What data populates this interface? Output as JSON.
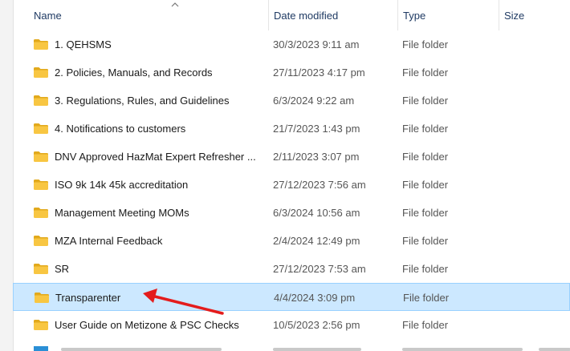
{
  "header": {
    "name": "Name",
    "date_modified": "Date modified",
    "type": "Type",
    "size": "Size"
  },
  "accent_colors": {
    "folder": "#f8c642",
    "folder_dark": "#e2a91c",
    "selection_bg": "#cce8ff",
    "selection_border": "#99d1ff",
    "annotation_arrow": "#e41c1c"
  },
  "rows": [
    {
      "name": "1. QEHSMS",
      "date": "30/3/2023 9:11 am",
      "type": "File folder",
      "icon": "folder-icon",
      "selected": false
    },
    {
      "name": "2. Policies, Manuals, and Records",
      "date": "27/11/2023 4:17 pm",
      "type": "File folder",
      "icon": "folder-icon",
      "selected": false
    },
    {
      "name": "3. Regulations, Rules, and Guidelines",
      "date": "6/3/2024 9:22 am",
      "type": "File folder",
      "icon": "folder-icon",
      "selected": false
    },
    {
      "name": "4. Notifications to customers",
      "date": "21/7/2023 1:43 pm",
      "type": "File folder",
      "icon": "folder-icon",
      "selected": false
    },
    {
      "name": "DNV Approved HazMat Expert Refresher ...",
      "date": "2/11/2023 3:07 pm",
      "type": "File folder",
      "icon": "folder-icon",
      "selected": false
    },
    {
      "name": "ISO 9k 14k 45k accreditation",
      "date": "27/12/2023 7:56 am",
      "type": "File folder",
      "icon": "folder-icon",
      "selected": false
    },
    {
      "name": "Management Meeting MOMs",
      "date": "6/3/2024 10:56 am",
      "type": "File folder",
      "icon": "folder-icon",
      "selected": false
    },
    {
      "name": "MZA Internal Feedback",
      "date": "2/4/2024 12:49 pm",
      "type": "File folder",
      "icon": "folder-icon",
      "selected": false
    },
    {
      "name": "SR",
      "date": "27/12/2023 7:53 am",
      "type": "File folder",
      "icon": "folder-icon",
      "selected": false
    },
    {
      "name": "Transparenter",
      "date": "4/4/2024 3:09 pm",
      "type": "File folder",
      "icon": "folder-icon",
      "selected": true
    },
    {
      "name": "User Guide on Metizone & PSC Checks",
      "date": "10/5/2023 2:56 pm",
      "type": "File folder",
      "icon": "folder-icon",
      "selected": false
    }
  ]
}
